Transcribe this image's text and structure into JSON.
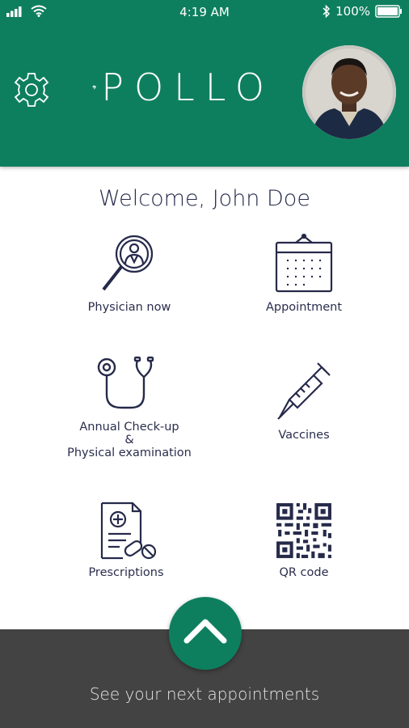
{
  "status_bar": {
    "time": "4:19 AM",
    "battery": "100%"
  },
  "header": {
    "brand_name": "POLLO",
    "avatar": "profile-photo"
  },
  "welcome": "Welcome, John Doe",
  "tiles": [
    {
      "label": "Physician now",
      "icon": "search-doctor-icon"
    },
    {
      "label": "Appointment",
      "icon": "calendar-icon"
    },
    {
      "label": "Annual Check-up\n&\nPhysical examination",
      "icon": "stethoscope-icon"
    },
    {
      "label": "Vaccines",
      "icon": "syringe-icon"
    },
    {
      "label": "Prescriptions",
      "icon": "prescription-icon"
    },
    {
      "label": "QR code",
      "icon": "qr-code-icon"
    }
  ],
  "footer": {
    "label": "See your next appointments"
  },
  "colors": {
    "brand_green": "#0e7f5e",
    "footer_gray": "#434343",
    "icon_navy": "#262a4a"
  }
}
